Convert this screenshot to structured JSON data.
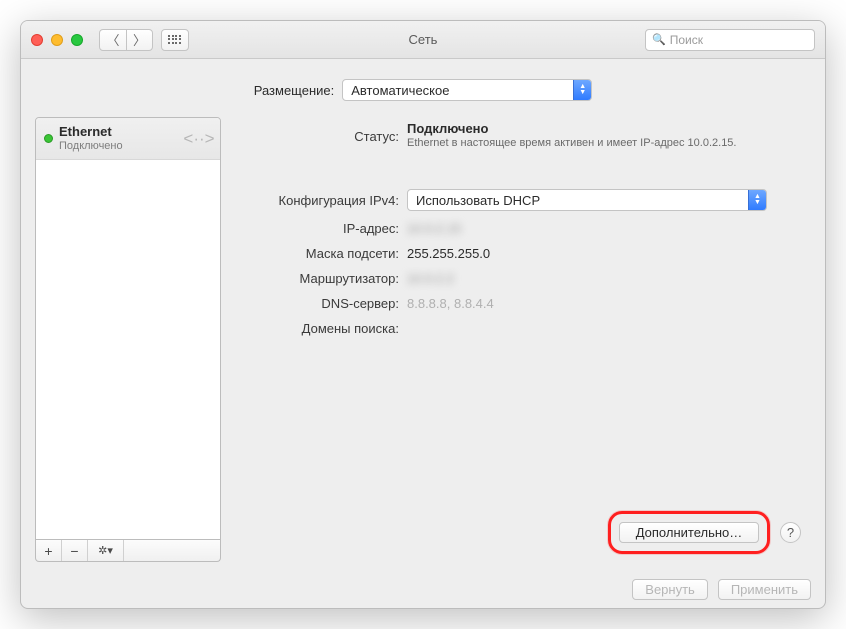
{
  "window": {
    "title": "Сеть"
  },
  "search": {
    "placeholder": "Поиск"
  },
  "location": {
    "label": "Размещение:",
    "value": "Автоматическое"
  },
  "services": [
    {
      "name": "Ethernet",
      "status_text": "Подключено",
      "status_color": "#3ac535",
      "icon": "ethernet-icon"
    }
  ],
  "list_buttons": {
    "add": "+",
    "remove": "−",
    "gear": "✱▾"
  },
  "details": {
    "status_label": "Статус:",
    "status_value": "Подключено",
    "status_description": "Ethernet в настоящее время активен и имеет IP-адрес 10.0.2.15.",
    "ipv4_config_label": "Конфигурация IPv4:",
    "ipv4_config_value": "Использовать DHCP",
    "ip_label": "IP-адрес:",
    "ip_value": "10.0.2.15",
    "mask_label": "Маска подсети:",
    "mask_value": "255.255.255.0",
    "router_label": "Маршрутизатор:",
    "router_value": "10.0.2.2",
    "dns_label": "DNS-сервер:",
    "dns_value": "8.8.8.8, 8.8.4.4",
    "search_domains_label": "Домены поиска:",
    "search_domains_value": ""
  },
  "buttons": {
    "advanced": "Дополнительно…",
    "help": "?",
    "revert": "Вернуть",
    "apply": "Применить"
  }
}
